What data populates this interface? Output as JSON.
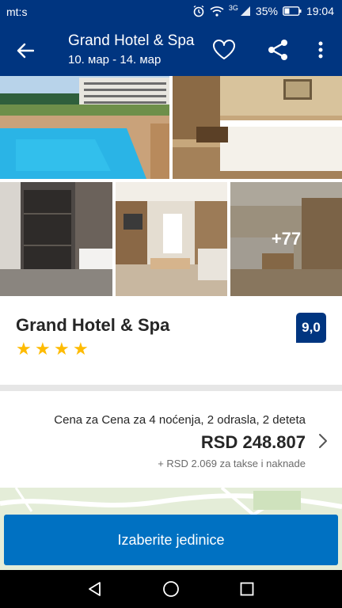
{
  "status_bar": {
    "carrier": "mt:s",
    "battery_percent": "35%",
    "time": "19:04",
    "network": "3G",
    "icons": [
      "alarm-icon",
      "wifi-icon",
      "signal-icon",
      "battery-icon"
    ]
  },
  "app_bar": {
    "title": "Grand Hotel & Spa",
    "dates": "10. мар - 14. мар",
    "icons": [
      "back-arrow-icon",
      "heart-icon",
      "share-icon",
      "more-vert-icon"
    ]
  },
  "gallery": {
    "more_count": "+77"
  },
  "hotel": {
    "name": "Grand Hotel & Spa",
    "stars": 4,
    "star_glyph": "★",
    "score": "9,0"
  },
  "price": {
    "description": "Cena za Cena za 4 noćenja, 2 odrasla, 2 deteta",
    "amount": "RSD 248.807",
    "fees": "+ RSD 2.069 za takse i naknade"
  },
  "cta": {
    "label": "Izaberite jedinice"
  },
  "colors": {
    "brand": "#003580",
    "cta": "#0071c2",
    "star": "#febb02"
  },
  "nav_bar": {
    "icons": [
      "nav-back-icon",
      "nav-home-icon",
      "nav-recents-icon"
    ]
  }
}
